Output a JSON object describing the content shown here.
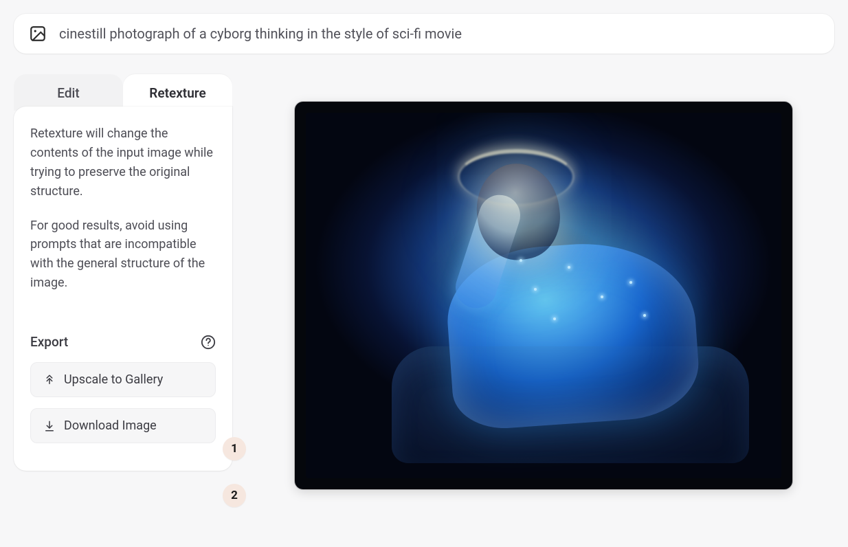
{
  "prompt": {
    "text": "cinestill photograph of a cyborg thinking in the style of sci-fi movie"
  },
  "tabs": {
    "edit": "Edit",
    "retexture": "Retexture",
    "active": "retexture"
  },
  "retexture": {
    "desc1": "Retexture will change the contents of the input image while trying to preserve the original structure.",
    "desc2": "For good results, avoid using prompts that are incompatible with the general structure of the image."
  },
  "export": {
    "label": "Export",
    "upscale": "Upscale to Gallery",
    "download": "Download Image"
  },
  "annotations": {
    "one": "1",
    "two": "2"
  }
}
